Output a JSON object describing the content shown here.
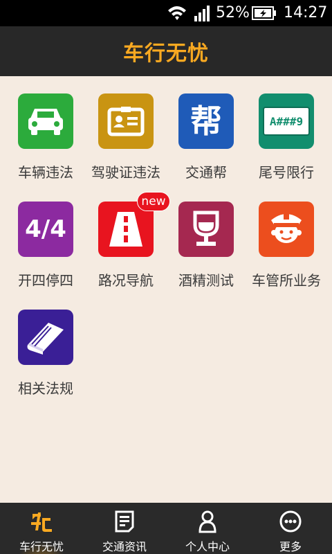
{
  "status_bar": {
    "battery_percent": "52%",
    "time": "14:27"
  },
  "header": {
    "title": "车行无忧"
  },
  "tiles": [
    {
      "label": "车辆违法",
      "icon": "car-icon",
      "color": "#2cab3c"
    },
    {
      "label": "驾驶证违法",
      "icon": "license-card-icon",
      "color": "#c99412"
    },
    {
      "label": "交通帮",
      "icon": "bang-icon",
      "icon_text": "帮",
      "color": "#1f5bb8"
    },
    {
      "label": "尾号限行",
      "icon": "plate-icon",
      "icon_text": "A###9",
      "color": "#128e6e"
    },
    {
      "label": "开四停四",
      "icon": "four-four-icon",
      "icon_text": "4/4",
      "color": "#8c2aa0"
    },
    {
      "label": "路况导航",
      "icon": "road-icon",
      "color": "#e8141f",
      "badge": "new"
    },
    {
      "label": "酒精测试",
      "icon": "wine-glass-icon",
      "color": "#a52850"
    },
    {
      "label": "车管所业务",
      "icon": "police-icon",
      "color": "#ec4e1e"
    },
    {
      "label": "相关法规",
      "icon": "book-icon",
      "color": "#3a1f96"
    }
  ],
  "bottom_nav": [
    {
      "label": "车行无忧",
      "icon": "home-logo-icon",
      "active": true
    },
    {
      "label": "交通资讯",
      "icon": "news-icon",
      "active": false
    },
    {
      "label": "个人中心",
      "icon": "person-icon",
      "active": false
    },
    {
      "label": "更多",
      "icon": "more-icon",
      "active": false
    }
  ]
}
